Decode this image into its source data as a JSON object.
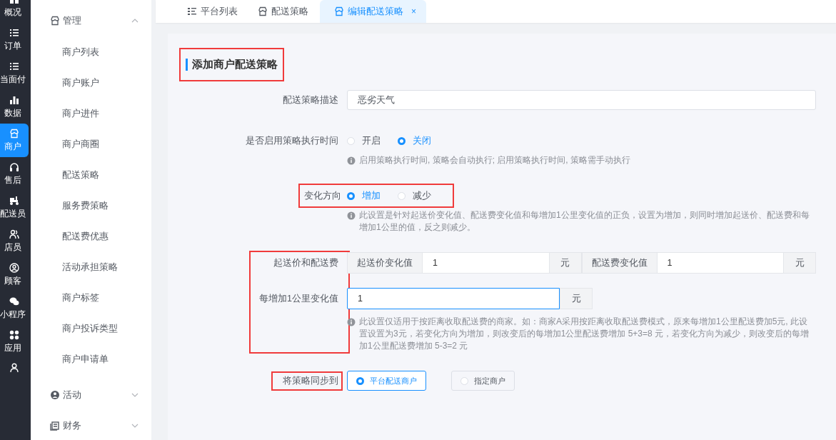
{
  "rail": {
    "items": [
      {
        "kind": "icon-label",
        "label": "概况",
        "selected": false
      },
      {
        "kind": "icon-label",
        "label": "订单",
        "selected": false
      },
      {
        "kind": "icon-label",
        "label": "当面付",
        "selected": false
      },
      {
        "kind": "icon-label",
        "label": "数据",
        "selected": false
      },
      {
        "kind": "icon-label",
        "label": "商户",
        "selected": true
      },
      {
        "kind": "icon-label",
        "label": "售后",
        "selected": false
      },
      {
        "kind": "icon-label",
        "label": "配送员",
        "selected": false
      },
      {
        "kind": "icon-label",
        "label": "店员",
        "selected": false
      },
      {
        "kind": "icon-label",
        "label": "顾客",
        "selected": false
      },
      {
        "kind": "icon-label",
        "label": "小程序",
        "selected": false
      },
      {
        "kind": "icon-label",
        "label": "应用",
        "selected": false
      },
      {
        "kind": "icon",
        "selected": false
      }
    ]
  },
  "submenu": {
    "groups": [
      {
        "label": "管理",
        "expanded": true,
        "children": [
          {
            "label": "商户列表",
            "selected": false
          },
          {
            "label": "商户账户",
            "selected": false
          },
          {
            "label": "商户进件",
            "selected": false
          },
          {
            "label": "商户商圈",
            "selected": false
          },
          {
            "label": "配送策略",
            "selected": false
          },
          {
            "label": "服务费策略",
            "selected": false
          },
          {
            "label": "配送费优惠",
            "selected": false
          },
          {
            "label": "活动承担策略",
            "selected": false
          },
          {
            "label": "商户标签",
            "selected": false
          },
          {
            "label": "商户投诉类型",
            "selected": false
          },
          {
            "label": "商户申请单",
            "selected": false
          }
        ]
      },
      {
        "label": "活动",
        "expanded": false
      },
      {
        "label": "财务",
        "expanded": false
      }
    ]
  },
  "tabs": [
    {
      "label": "平台列表",
      "selected": false
    },
    {
      "label": "配送策略",
      "selected": false
    },
    {
      "label": "编辑配送策略",
      "selected": true,
      "close": "×"
    }
  ],
  "form": {
    "title": {
      "text": "添加商户配送策略",
      "highlighted": true
    },
    "fields": [
      {
        "kind": "text",
        "label": "配送策略描述",
        "value": "恶劣天气"
      },
      {
        "kind": "radio",
        "label": "是否启用策略执行时间",
        "options": [
          {
            "label": "开启",
            "selected": false
          },
          {
            "label": "关闭",
            "selected": true
          }
        ],
        "hint": "启用策略执行时间, 策略会自动执行; 启用策略执行时间, 策略需手动执行"
      },
      {
        "kind": "radio",
        "label": "变化方向",
        "highlighted": true,
        "options": [
          {
            "label": "增加",
            "selected": true
          },
          {
            "label": "减少",
            "selected": false
          }
        ],
        "hint": "此设置是针对起送价变化值、配送费变化值和每增加1公里变化值的正负，设置为增加，则同时增加起送价、配送费和每增加1公里的值，反之则减少。"
      },
      {
        "kind": "fee-group",
        "highlighted": true,
        "rows": [
          {
            "label": "起送价和配送费",
            "inputs": [
              {
                "prepend": "起送价变化值",
                "value": "1",
                "append": "元",
                "focused": false
              },
              {
                "prepend": "配送费变化值",
                "value": "1",
                "append": "元",
                "focused": false
              }
            ]
          },
          {
            "label": "每增加1公里变化值",
            "inputs": [
              {
                "value": "1",
                "append": "元",
                "focused": true
              }
            ]
          }
        ],
        "hint": "此设置仅适用于按距离收取配送费的商家。如：商家A采用按距离收取配送费模式，原来每增加1公里配送费加5元, 此设置设置为3元，若变化方向为增加，则改变后的每增加1公里配送费增加 5+3=8 元，若变化方向为减少，则改变后的每增加1公里配送费增加 5-3=2 元"
      },
      {
        "kind": "button-radio",
        "label": "将策略同步到",
        "highlighted": true,
        "options": [
          {
            "label": "平台配送商户",
            "selected": true
          },
          {
            "label": "指定商户",
            "selected": false
          }
        ]
      }
    ]
  }
}
